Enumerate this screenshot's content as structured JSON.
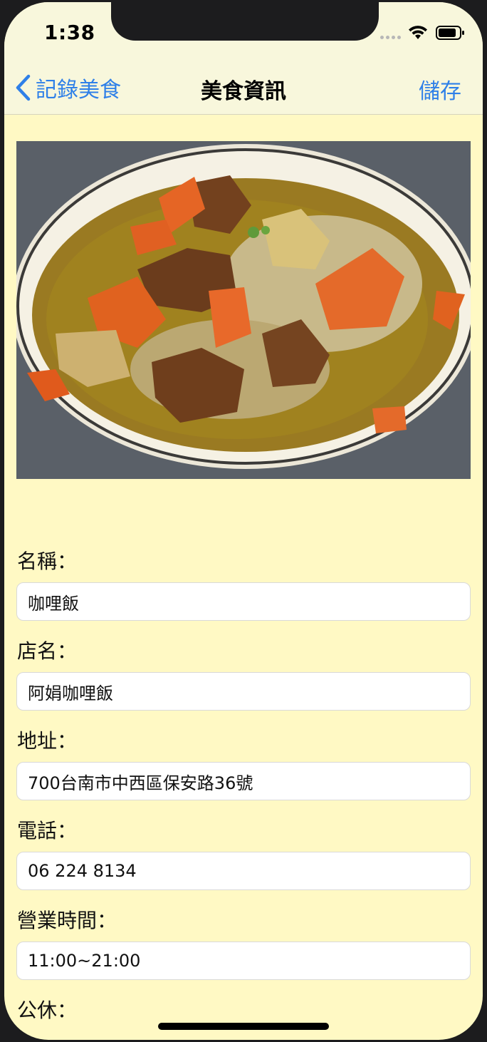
{
  "status_bar": {
    "time": "1:38"
  },
  "nav": {
    "back_label": "記錄美食",
    "title": "美食資訊",
    "save_label": "儲存"
  },
  "fields": [
    {
      "label": "名稱：",
      "value": "咖哩飯"
    },
    {
      "label": "店名：",
      "value": "阿娟咖哩飯"
    },
    {
      "label": "地址：",
      "value": "700台南市中西區保安路36號"
    },
    {
      "label": "電話：",
      "value": "06 224 8134"
    },
    {
      "label": "營業時間：",
      "value": "11:00~21:00"
    },
    {
      "label": "公休："
    }
  ],
  "colors": {
    "accent": "#2f80e8",
    "background": "#fff9c4",
    "nav_background": "#f8f7dc"
  },
  "icons": {
    "back": "chevron-left-icon",
    "signal": "cellular-signal-icon",
    "wifi": "wifi-icon",
    "battery": "battery-icon"
  }
}
